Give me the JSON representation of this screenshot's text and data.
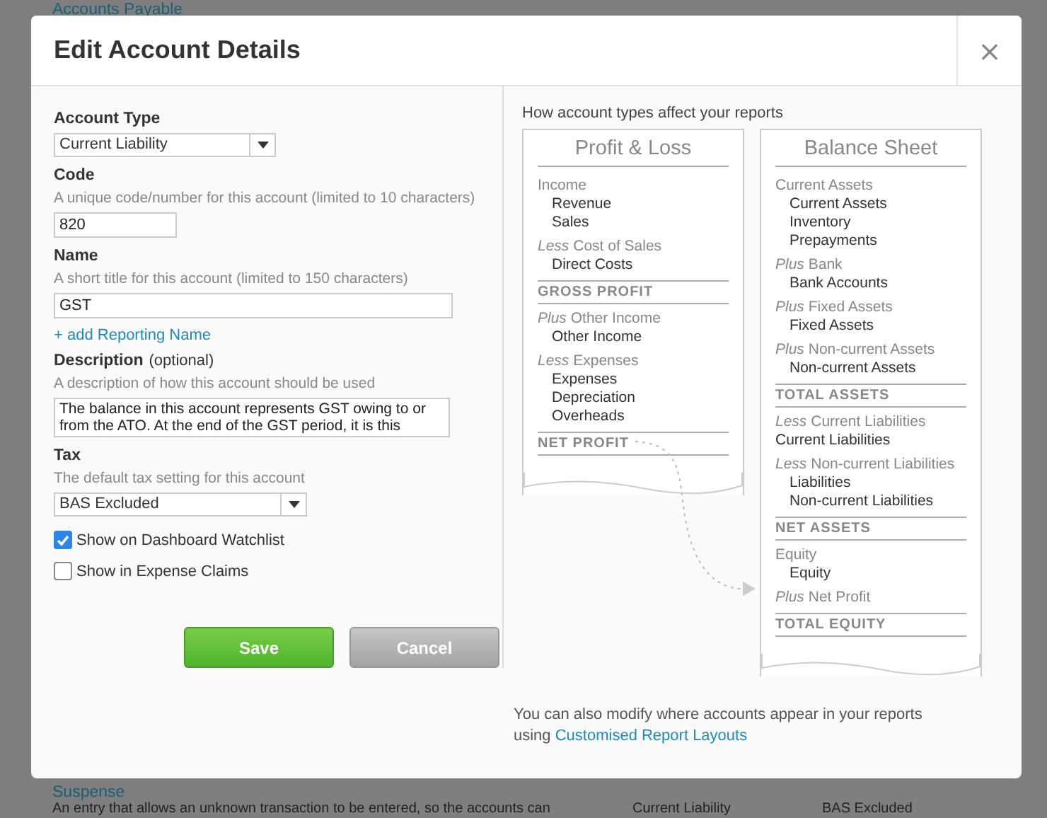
{
  "background": {
    "top_link": "Accounts Payable",
    "bottom_row": {
      "name": "Suspense",
      "description": "An entry that allows an unknown transaction to be entered, so the accounts can",
      "type": "Current Liability",
      "tax": "BAS Excluded"
    }
  },
  "dialog": {
    "title": "Edit Account Details",
    "close": "×"
  },
  "form": {
    "account_type": {
      "label": "Account Type",
      "value": "Current Liability"
    },
    "code": {
      "label": "Code",
      "hint": "A unique code/number for this account (limited to 10 characters)",
      "value": "820"
    },
    "name": {
      "label": "Name",
      "hint": "A short title for this account (limited to 150 characters)",
      "value": "GST"
    },
    "add_reporting_name": "+ add Reporting Name",
    "description": {
      "label": "Description",
      "optional": "(optional)",
      "hint": "A description of how this account should be used",
      "value": "The balance in this account represents GST owing to or from the ATO. At the end of the GST period, it is this"
    },
    "tax": {
      "label": "Tax",
      "hint": "The default tax setting for this account",
      "value": "BAS Excluded"
    },
    "checkboxes": [
      {
        "label": "Show on Dashboard Watchlist",
        "checked": true
      },
      {
        "label": "Show in Expense Claims",
        "checked": false
      }
    ],
    "buttons": [
      {
        "label": "Save",
        "kind": "primary"
      },
      {
        "label": "Cancel",
        "kind": "secondary"
      }
    ]
  },
  "reports": {
    "heading": "How account types affect your reports",
    "cards": [
      {
        "title": "Profit & Loss",
        "lines": [
          {
            "kind": "heading",
            "text": "Income"
          },
          {
            "kind": "sub",
            "text": "Revenue"
          },
          {
            "kind": "sub",
            "text": "Sales"
          },
          {
            "kind": "heading",
            "text": "*Less* Cost of Sales"
          },
          {
            "kind": "sub",
            "text": "Direct Costs"
          },
          {
            "kind": "total",
            "text": "GROSS PROFIT"
          },
          {
            "kind": "heading",
            "text": "*Plus* Other Income"
          },
          {
            "kind": "sub",
            "text": "Other Income"
          },
          {
            "kind": "heading",
            "text": "*Less* Expenses"
          },
          {
            "kind": "sub",
            "text": "Expenses"
          },
          {
            "kind": "sub",
            "text": "Depreciation"
          },
          {
            "kind": "sub",
            "text": "Overheads"
          },
          {
            "kind": "total",
            "text": "NET PROFIT"
          }
        ]
      },
      {
        "title": "Balance Sheet",
        "lines": [
          {
            "kind": "heading",
            "text": "Current Assets"
          },
          {
            "kind": "sub",
            "text": "Current Assets"
          },
          {
            "kind": "sub",
            "text": "Inventory"
          },
          {
            "kind": "sub",
            "text": "Prepayments"
          },
          {
            "kind": "heading",
            "text": "*Plus* Bank"
          },
          {
            "kind": "sub",
            "text": "Bank Accounts"
          },
          {
            "kind": "heading",
            "text": "*Plus* Fixed Assets"
          },
          {
            "kind": "sub",
            "text": "Fixed Assets"
          },
          {
            "kind": "heading",
            "text": "*Plus* Non-current Assets"
          },
          {
            "kind": "sub",
            "text": "Non-current Assets"
          },
          {
            "kind": "total",
            "text": "TOTAL ASSETS"
          },
          {
            "kind": "heading",
            "text": "*Less* Current Liabilities"
          },
          {
            "kind": "account",
            "text": "Current Liabilities"
          },
          {
            "kind": "heading",
            "text": "*Less* Non-current Liabilities"
          },
          {
            "kind": "sub",
            "text": "Liabilities"
          },
          {
            "kind": "sub",
            "text": "Non-current Liabilities"
          },
          {
            "kind": "total",
            "text": "NET ASSETS"
          },
          {
            "kind": "heading",
            "text": "Equity"
          },
          {
            "kind": "sub",
            "text": "Equity"
          },
          {
            "kind": "heading",
            "text": "*Plus* Net Profit"
          },
          {
            "kind": "total",
            "text": "TOTAL EQUITY"
          }
        ]
      }
    ],
    "footer": {
      "text": "You can also modify where accounts appear in your reports using",
      "link": "Customised Report Layouts"
    }
  }
}
